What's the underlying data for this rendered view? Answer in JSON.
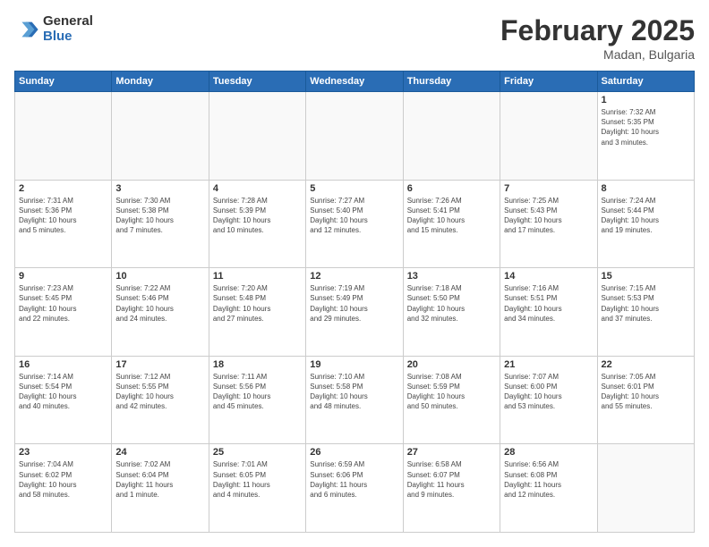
{
  "logo": {
    "general": "General",
    "blue": "Blue"
  },
  "header": {
    "title": "February 2025",
    "subtitle": "Madan, Bulgaria"
  },
  "weekdays": [
    "Sunday",
    "Monday",
    "Tuesday",
    "Wednesday",
    "Thursday",
    "Friday",
    "Saturday"
  ],
  "weeks": [
    [
      {
        "day": "",
        "info": ""
      },
      {
        "day": "",
        "info": ""
      },
      {
        "day": "",
        "info": ""
      },
      {
        "day": "",
        "info": ""
      },
      {
        "day": "",
        "info": ""
      },
      {
        "day": "",
        "info": ""
      },
      {
        "day": "1",
        "info": "Sunrise: 7:32 AM\nSunset: 5:35 PM\nDaylight: 10 hours\nand 3 minutes."
      }
    ],
    [
      {
        "day": "2",
        "info": "Sunrise: 7:31 AM\nSunset: 5:36 PM\nDaylight: 10 hours\nand 5 minutes."
      },
      {
        "day": "3",
        "info": "Sunrise: 7:30 AM\nSunset: 5:38 PM\nDaylight: 10 hours\nand 7 minutes."
      },
      {
        "day": "4",
        "info": "Sunrise: 7:28 AM\nSunset: 5:39 PM\nDaylight: 10 hours\nand 10 minutes."
      },
      {
        "day": "5",
        "info": "Sunrise: 7:27 AM\nSunset: 5:40 PM\nDaylight: 10 hours\nand 12 minutes."
      },
      {
        "day": "6",
        "info": "Sunrise: 7:26 AM\nSunset: 5:41 PM\nDaylight: 10 hours\nand 15 minutes."
      },
      {
        "day": "7",
        "info": "Sunrise: 7:25 AM\nSunset: 5:43 PM\nDaylight: 10 hours\nand 17 minutes."
      },
      {
        "day": "8",
        "info": "Sunrise: 7:24 AM\nSunset: 5:44 PM\nDaylight: 10 hours\nand 19 minutes."
      }
    ],
    [
      {
        "day": "9",
        "info": "Sunrise: 7:23 AM\nSunset: 5:45 PM\nDaylight: 10 hours\nand 22 minutes."
      },
      {
        "day": "10",
        "info": "Sunrise: 7:22 AM\nSunset: 5:46 PM\nDaylight: 10 hours\nand 24 minutes."
      },
      {
        "day": "11",
        "info": "Sunrise: 7:20 AM\nSunset: 5:48 PM\nDaylight: 10 hours\nand 27 minutes."
      },
      {
        "day": "12",
        "info": "Sunrise: 7:19 AM\nSunset: 5:49 PM\nDaylight: 10 hours\nand 29 minutes."
      },
      {
        "day": "13",
        "info": "Sunrise: 7:18 AM\nSunset: 5:50 PM\nDaylight: 10 hours\nand 32 minutes."
      },
      {
        "day": "14",
        "info": "Sunrise: 7:16 AM\nSunset: 5:51 PM\nDaylight: 10 hours\nand 34 minutes."
      },
      {
        "day": "15",
        "info": "Sunrise: 7:15 AM\nSunset: 5:53 PM\nDaylight: 10 hours\nand 37 minutes."
      }
    ],
    [
      {
        "day": "16",
        "info": "Sunrise: 7:14 AM\nSunset: 5:54 PM\nDaylight: 10 hours\nand 40 minutes."
      },
      {
        "day": "17",
        "info": "Sunrise: 7:12 AM\nSunset: 5:55 PM\nDaylight: 10 hours\nand 42 minutes."
      },
      {
        "day": "18",
        "info": "Sunrise: 7:11 AM\nSunset: 5:56 PM\nDaylight: 10 hours\nand 45 minutes."
      },
      {
        "day": "19",
        "info": "Sunrise: 7:10 AM\nSunset: 5:58 PM\nDaylight: 10 hours\nand 48 minutes."
      },
      {
        "day": "20",
        "info": "Sunrise: 7:08 AM\nSunset: 5:59 PM\nDaylight: 10 hours\nand 50 minutes."
      },
      {
        "day": "21",
        "info": "Sunrise: 7:07 AM\nSunset: 6:00 PM\nDaylight: 10 hours\nand 53 minutes."
      },
      {
        "day": "22",
        "info": "Sunrise: 7:05 AM\nSunset: 6:01 PM\nDaylight: 10 hours\nand 55 minutes."
      }
    ],
    [
      {
        "day": "23",
        "info": "Sunrise: 7:04 AM\nSunset: 6:02 PM\nDaylight: 10 hours\nand 58 minutes."
      },
      {
        "day": "24",
        "info": "Sunrise: 7:02 AM\nSunset: 6:04 PM\nDaylight: 11 hours\nand 1 minute."
      },
      {
        "day": "25",
        "info": "Sunrise: 7:01 AM\nSunset: 6:05 PM\nDaylight: 11 hours\nand 4 minutes."
      },
      {
        "day": "26",
        "info": "Sunrise: 6:59 AM\nSunset: 6:06 PM\nDaylight: 11 hours\nand 6 minutes."
      },
      {
        "day": "27",
        "info": "Sunrise: 6:58 AM\nSunset: 6:07 PM\nDaylight: 11 hours\nand 9 minutes."
      },
      {
        "day": "28",
        "info": "Sunrise: 6:56 AM\nSunset: 6:08 PM\nDaylight: 11 hours\nand 12 minutes."
      },
      {
        "day": "",
        "info": ""
      }
    ]
  ]
}
